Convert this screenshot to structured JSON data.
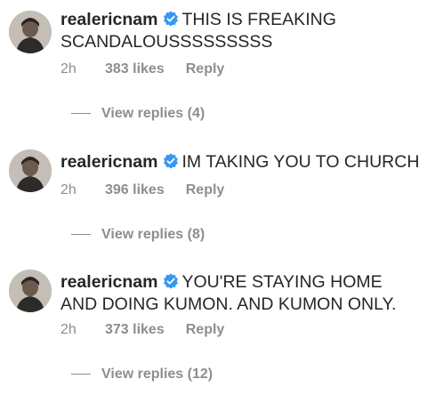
{
  "comments": [
    {
      "username": "realericnam",
      "text": "THIS IS FREAKING SCANDALOUSSSSSSSSS",
      "time": "2h",
      "likes": "383 likes",
      "reply_label": "Reply",
      "view_replies": "View replies (4)"
    },
    {
      "username": "realericnam",
      "text": "IM TAKING YOU TO CHURCH",
      "time": "2h",
      "likes": "396 likes",
      "reply_label": "Reply",
      "view_replies": "View replies (8)"
    },
    {
      "username": "realericnam",
      "text": "YOU'RE STAYING HOME AND DOING KUMON. AND KUMON ONLY.",
      "time": "2h",
      "likes": "373 likes",
      "reply_label": "Reply",
      "view_replies": "View replies (12)"
    }
  ],
  "icons": {
    "verified": "verified-badge-icon",
    "avatar": "profile-avatar"
  },
  "colors": {
    "verified_blue": "#3897f0",
    "meta_gray": "#8e8e8e",
    "text": "#262626"
  }
}
